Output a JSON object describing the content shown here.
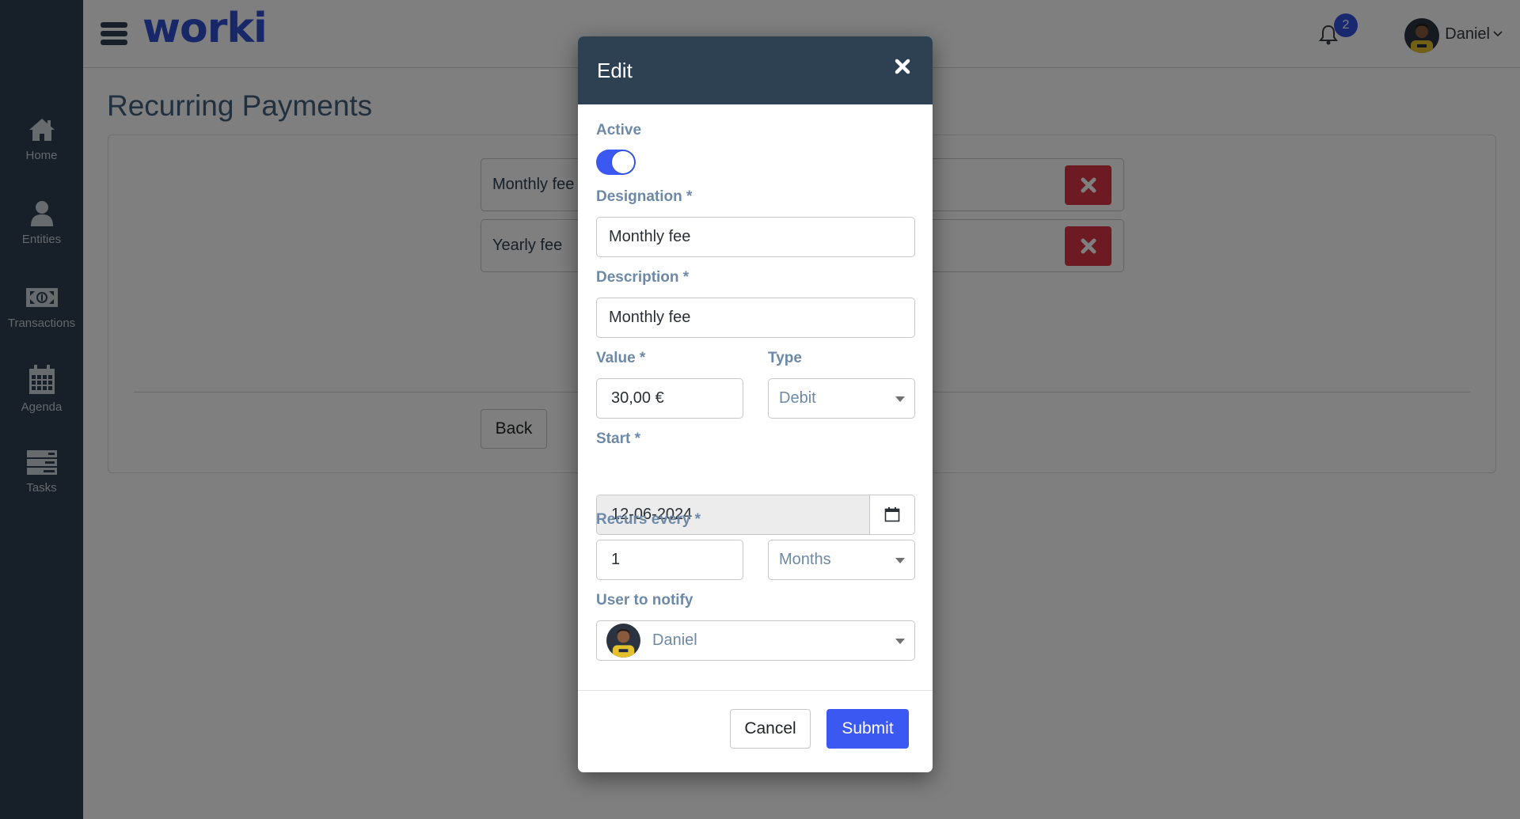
{
  "app": {
    "logo": "worki",
    "brand_color": "#2f4fd1"
  },
  "sidebar": {
    "items": [
      {
        "label": "Home",
        "icon": "home-icon"
      },
      {
        "label": "Entities",
        "icon": "user-icon"
      },
      {
        "label": "Transactions",
        "icon": "money-bill-icon"
      },
      {
        "label": "Agenda",
        "icon": "calendar-icon"
      },
      {
        "label": "Tasks",
        "icon": "server-icon"
      }
    ]
  },
  "header": {
    "notifications_count": "2",
    "user_name": "Daniel"
  },
  "page": {
    "title": "Recurring Payments",
    "rows": [
      {
        "label": "Monthly fee"
      },
      {
        "label": "Yearly fee"
      }
    ],
    "back_label": "Back"
  },
  "modal": {
    "title": "Edit",
    "active_label": "Active",
    "active": true,
    "designation_label": "Designation *",
    "designation_value": "Monthly fee",
    "description_label": "Description *",
    "description_value": "Monthly fee",
    "value_label": "Value *",
    "value_value": "30,00 €",
    "type_label": "Type",
    "type_value": "Debit",
    "start_label": "Start *",
    "start_value": "12-06-2024",
    "recurs_label": "Recurs every *",
    "recurs_value": "1",
    "recurs_unit": "Months",
    "notify_label": "User to notify",
    "notify_value": "Daniel",
    "cancel_label": "Cancel",
    "submit_label": "Submit",
    "accent_color": "#3b58f2",
    "header_color": "#2e4153"
  }
}
